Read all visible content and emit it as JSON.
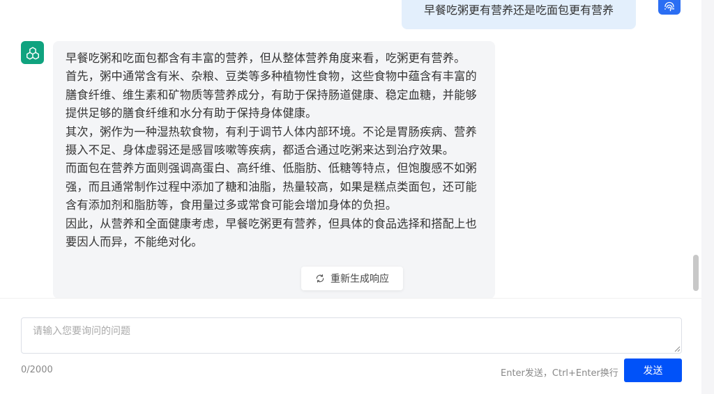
{
  "user_message": {
    "text": "早餐吃粥更有营养还是吃面包更有营养",
    "avatar_icon": "fingerprint-icon",
    "accent": "#2b6ef3"
  },
  "assistant_message": {
    "avatar_icon": "openai-logo-icon",
    "avatar_color": "#10a37f",
    "paragraphs": [
      "早餐吃粥和吃面包都含有丰富的营养，但从整体营养角度来看，吃粥更有营养。",
      "首先，粥中通常含有米、杂粮、豆类等多种植物性食物，这些食物中蕴含有丰富的膳食纤维、维生素和矿物质等营养成分，有助于保持肠道健康、稳定血糖，并能够提供足够的膳食纤维和水分有助于保持身体健康。",
      "其次，粥作为一种湿热软食物，有利于调节人体内部环境。不论是胃肠疾病、营养摄入不足、身体虚弱还是感冒咳嗽等疾病，都适合通过吃粥来达到治疗效果。",
      "而面包在营养方面则强调高蛋白、高纤维、低脂肪、低糖等特点，但饱腹感不如粥强，而且通常制作过程中添加了糖和油脂，热量较高，如果是糕点类面包，还可能含有添加剂和脂肪等，食用量过多或常食可能会增加身体的负担。",
      "因此，从营养和全面健康考虑，早餐吃粥更有营养，但具体的食品选择和搭配上也要因人而异，不能绝对化。"
    ]
  },
  "regenerate": {
    "label": "重新生成响应",
    "icon": "refresh-icon"
  },
  "input": {
    "placeholder": "请输入您要询问的问题",
    "value": "",
    "char_count": "0/2000",
    "hint": "Enter发送，Ctrl+Enter换行",
    "send_label": "发送"
  },
  "colors": {
    "send_button": "#0052f9",
    "user_bubble": "#e3effc",
    "assistant_bubble": "#f4f5f7"
  }
}
